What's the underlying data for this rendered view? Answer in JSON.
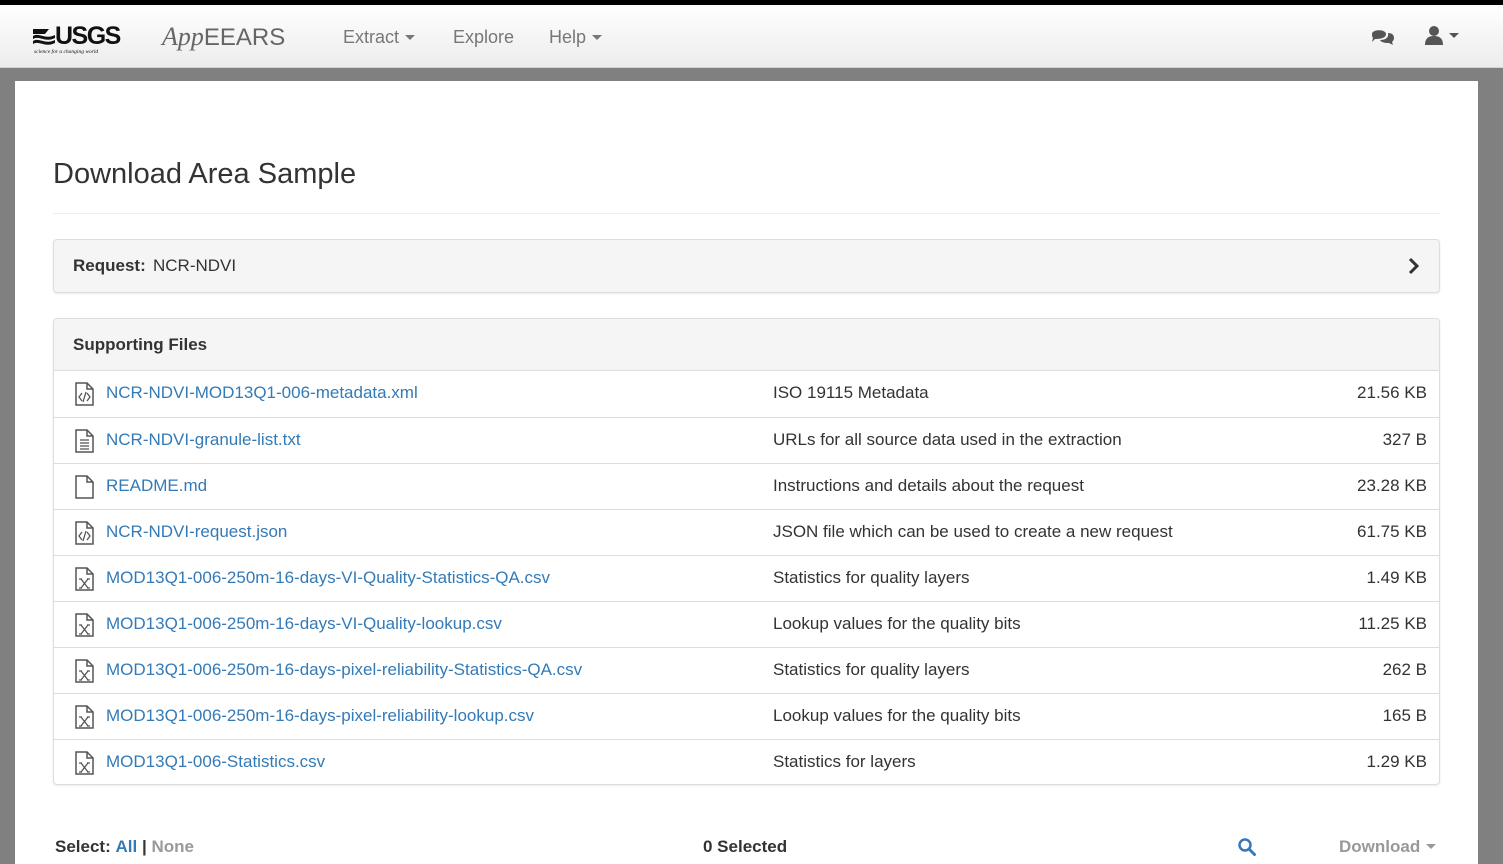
{
  "navbar": {
    "logo_text": "USGS",
    "logo_tagline": "science for a changing world",
    "brand_prefix": "App",
    "brand_suffix": "EEARS",
    "items": [
      {
        "label": "Extract",
        "dropdown": true
      },
      {
        "label": "Explore",
        "dropdown": false
      },
      {
        "label": "Help",
        "dropdown": true
      }
    ],
    "icons": [
      "comments-icon",
      "user-icon"
    ]
  },
  "page": {
    "title": "Download Area Sample"
  },
  "request": {
    "label": "Request:",
    "value": "NCR-NDVI"
  },
  "supporting_files": {
    "heading": "Supporting Files",
    "files": [
      {
        "name": "NCR-NDVI-MOD13Q1-006-metadata.xml",
        "description": "ISO 19115 Metadata",
        "size": "21.56 KB",
        "icon": "code-file-icon"
      },
      {
        "name": "NCR-NDVI-granule-list.txt",
        "description": "URLs for all source data used in the extraction",
        "size": "327 B",
        "icon": "text-file-icon"
      },
      {
        "name": "README.md",
        "description": "Instructions and details about the request",
        "size": "23.28 KB",
        "icon": "blank-file-icon"
      },
      {
        "name": "NCR-NDVI-request.json",
        "description": "JSON file which can be used to create a new request",
        "size": "61.75 KB",
        "icon": "code-file-icon"
      },
      {
        "name": "MOD13Q1-006-250m-16-days-VI-Quality-Statistics-QA.csv",
        "description": "Statistics for quality layers",
        "size": "1.49 KB",
        "icon": "excel-file-icon"
      },
      {
        "name": "MOD13Q1-006-250m-16-days-VI-Quality-lookup.csv",
        "description": "Lookup values for the quality bits",
        "size": "11.25 KB",
        "icon": "excel-file-icon"
      },
      {
        "name": "MOD13Q1-006-250m-16-days-pixel-reliability-Statistics-QA.csv",
        "description": "Statistics for quality layers",
        "size": "262 B",
        "icon": "excel-file-icon"
      },
      {
        "name": "MOD13Q1-006-250m-16-days-pixel-reliability-lookup.csv",
        "description": "Lookup values for the quality bits",
        "size": "165 B",
        "icon": "excel-file-icon"
      },
      {
        "name": "MOD13Q1-006-Statistics.csv",
        "description": "Statistics for layers",
        "size": "1.29 KB",
        "icon": "excel-file-icon"
      }
    ]
  },
  "footer": {
    "select_label": "Select:",
    "select_all": "All",
    "separator": "|",
    "select_none": "None",
    "selected_count": "0 Selected",
    "download_label": "Download"
  },
  "colors": {
    "link": "#337ab7",
    "muted": "#999999",
    "panel_heading_bg": "#f5f5f5",
    "backdrop": "#808080"
  }
}
